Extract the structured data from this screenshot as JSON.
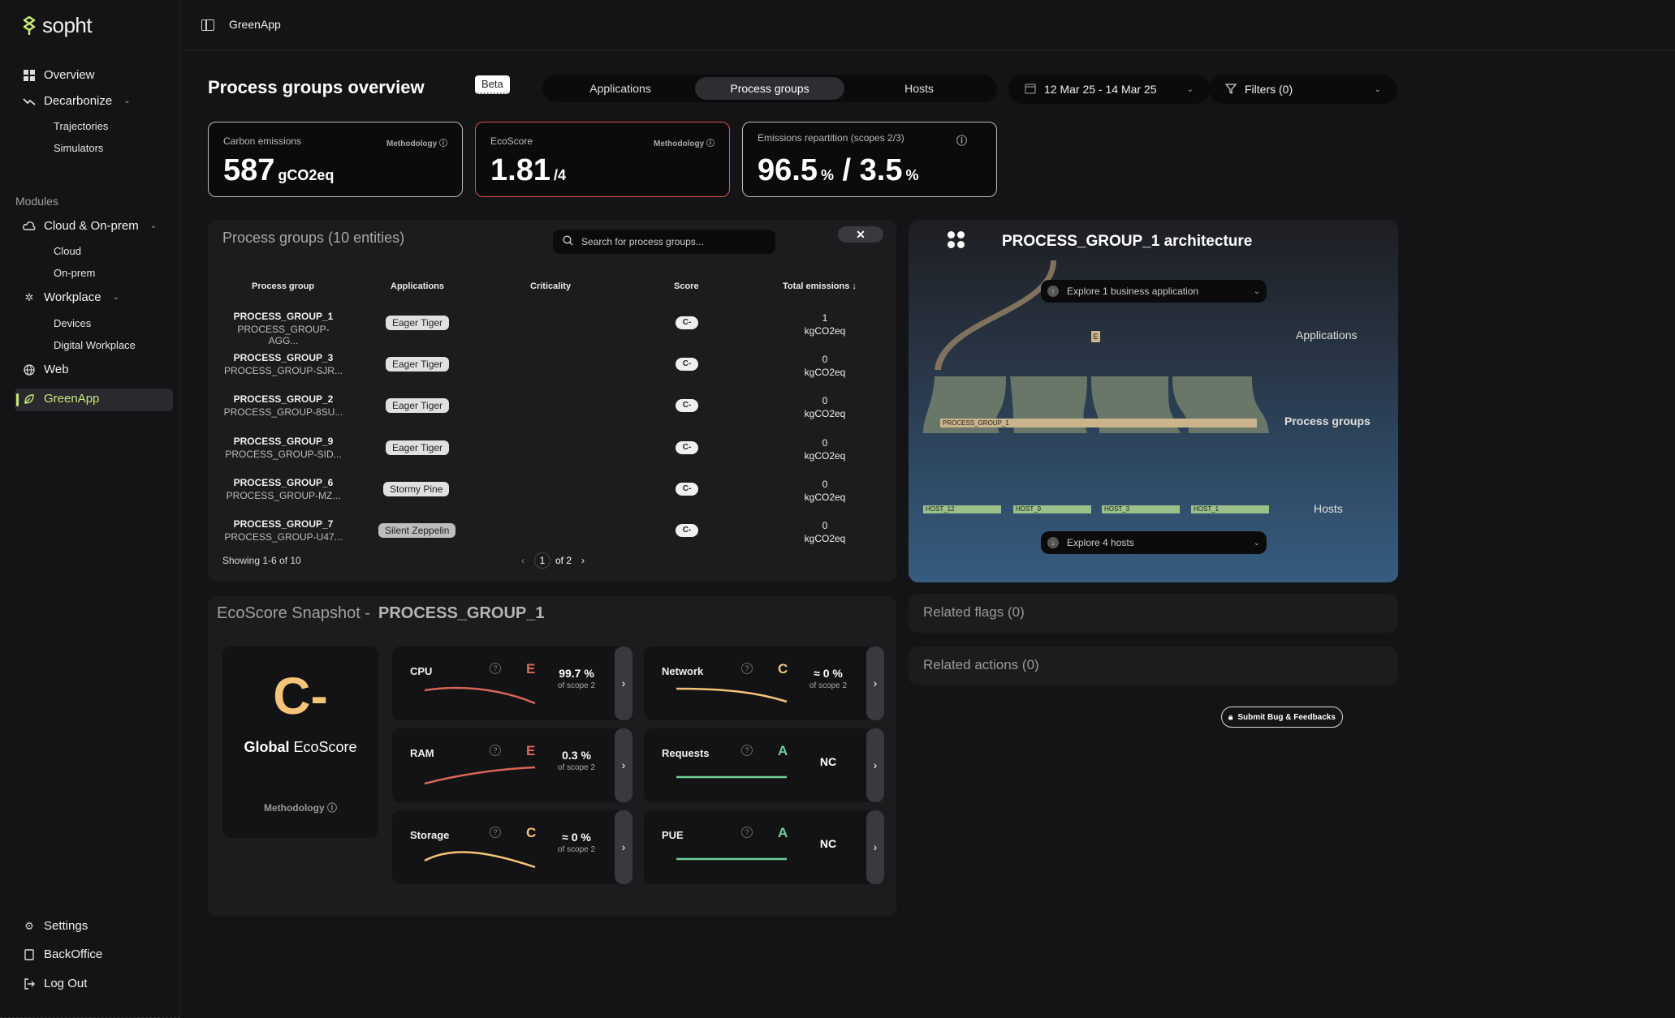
{
  "sidebar": {
    "logo": "sopht",
    "items": {
      "overview": "Overview",
      "decarbonize": "Decarbonize",
      "trajectories": "Trajectories",
      "simulators": "Simulators",
      "modules_heading": "Modules",
      "cloud_onprem": "Cloud & On-prem",
      "cloud": "Cloud",
      "onprem": "On-prem",
      "workplace": "Workplace",
      "devices": "Devices",
      "digital_workplace": "Digital Workplace",
      "web": "Web",
      "greenapp": "GreenApp",
      "settings": "Settings",
      "backoffice": "BackOffice",
      "logout": "Log Out"
    }
  },
  "topbar": {
    "title": "GreenApp"
  },
  "header": {
    "title": "Process groups overview",
    "beta": "Beta",
    "tabs": [
      "Applications",
      "Process groups",
      "Hosts"
    ],
    "active_tab": "Process groups",
    "date_range": "12 Mar 25 - 14 Mar 25",
    "filters": "Filters (0)"
  },
  "kpis": {
    "carbon": {
      "label": "Carbon emissions",
      "methodology": "Methodology",
      "value": "587",
      "unit": "gCO2eq"
    },
    "ecoscore": {
      "label": "EcoScore",
      "methodology": "Methodology",
      "value": "1.81",
      "unit": "/4"
    },
    "repartition": {
      "label": "Emissions repartition (scopes 2/3)",
      "value_a": "96.5",
      "unit_a": "%",
      "sep": "/",
      "value_b": "3.5",
      "unit_b": "%"
    }
  },
  "table": {
    "title": "Process groups (10 entities)",
    "search_placeholder": "Search for process groups...",
    "close": "✕",
    "columns": [
      "Process group",
      "Applications",
      "Criticality",
      "Score",
      "Total emissions ↓"
    ],
    "rows": [
      {
        "name": "PROCESS_GROUP_1",
        "sub": "PROCESS_GROUP-AGG...",
        "app": "Eager Tiger",
        "score": "C-",
        "emis": "1",
        "unit": "kgCO2eq"
      },
      {
        "name": "PROCESS_GROUP_3",
        "sub": "PROCESS_GROUP-SJR...",
        "app": "Eager Tiger",
        "score": "C-",
        "emis": "0",
        "unit": "kgCO2eq"
      },
      {
        "name": "PROCESS_GROUP_2",
        "sub": "PROCESS_GROUP-8SU...",
        "app": "Eager Tiger",
        "score": "C-",
        "emis": "0",
        "unit": "kgCO2eq"
      },
      {
        "name": "PROCESS_GROUP_9",
        "sub": "PROCESS_GROUP-SID...",
        "app": "Eager Tiger",
        "score": "C-",
        "emis": "0",
        "unit": "kgCO2eq"
      },
      {
        "name": "PROCESS_GROUP_6",
        "sub": "PROCESS_GROUP-MZ...",
        "app": "Stormy Pine",
        "score": "C-",
        "emis": "0",
        "unit": "kgCO2eq"
      },
      {
        "name": "PROCESS_GROUP_7",
        "sub": "PROCESS_GROUP-U47...",
        "app": "Silent Zeppelin",
        "score": "C-",
        "emis": "0",
        "unit": "kgCO2eq"
      }
    ],
    "showing": "Showing 1-6 of 10",
    "page": "1",
    "of_pages": "of 2"
  },
  "architecture": {
    "title": "PROCESS_GROUP_1 architecture",
    "explore_apps": "Explore 1 business application",
    "explore_hosts": "Explore 4 hosts",
    "lbl_applications": "Applications",
    "lbl_process_groups": "Process groups",
    "lbl_hosts": "Hosts",
    "app_node": "E",
    "pg_node": "PROCESS_GROUP_1",
    "hosts": [
      "HOST_12",
      "HOST_9",
      "HOST_3",
      "HOST_1"
    ]
  },
  "related": {
    "flags": "Related flags (0)",
    "actions": "Related actions (0)",
    "bug": "Submit Bug & Feedbacks"
  },
  "eco": {
    "title": "EcoScore Snapshot -",
    "group": "PROCESS_GROUP_1",
    "global_grade": "C-",
    "global_bold": "Global",
    "global_rest": " EcoScore",
    "methodology": "Methodology",
    "metrics": {
      "cpu": {
        "name": "CPU",
        "grade": "E",
        "pct": "99.7 %",
        "sub": "of scope 2"
      },
      "ram": {
        "name": "RAM",
        "grade": "E",
        "pct": "0.3 %",
        "sub": "of scope 2"
      },
      "storage": {
        "name": "Storage",
        "grade": "C",
        "pct": "≈ 0 %",
        "sub": "of scope 2"
      },
      "network": {
        "name": "Network",
        "grade": "C",
        "pct": "≈ 0 %",
        "sub": "of scope 2"
      },
      "requests": {
        "name": "Requests",
        "grade": "A",
        "pct": "NC"
      },
      "pue": {
        "name": "PUE",
        "grade": "A",
        "pct": "NC"
      }
    }
  },
  "colors": {
    "grade_e": "#e06a5a",
    "grade_c": "#f4c579",
    "grade_a": "#6fcf97",
    "accent": "#c8e87a"
  }
}
